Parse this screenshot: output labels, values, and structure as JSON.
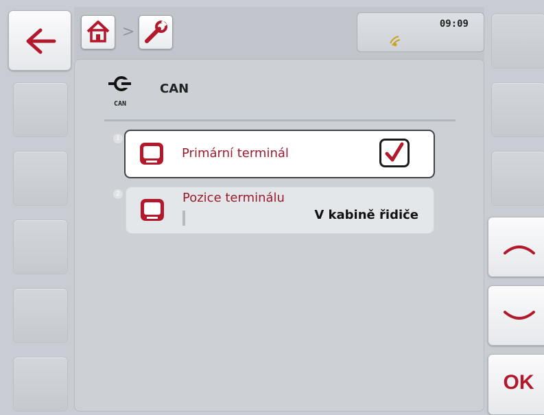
{
  "status": {
    "time": "09:09"
  },
  "page": {
    "title": "CAN",
    "icon_label": "CAN"
  },
  "items": [
    {
      "index": "1",
      "label": "Primární terminál",
      "checked": true
    },
    {
      "index": "2",
      "label": "Pozice terminálu",
      "value": "V kabině řidiče"
    }
  ],
  "softkeys": {
    "ok_label": "OK"
  },
  "colors": {
    "accent": "#9b1b2c",
    "background": "#c9cdd3"
  }
}
